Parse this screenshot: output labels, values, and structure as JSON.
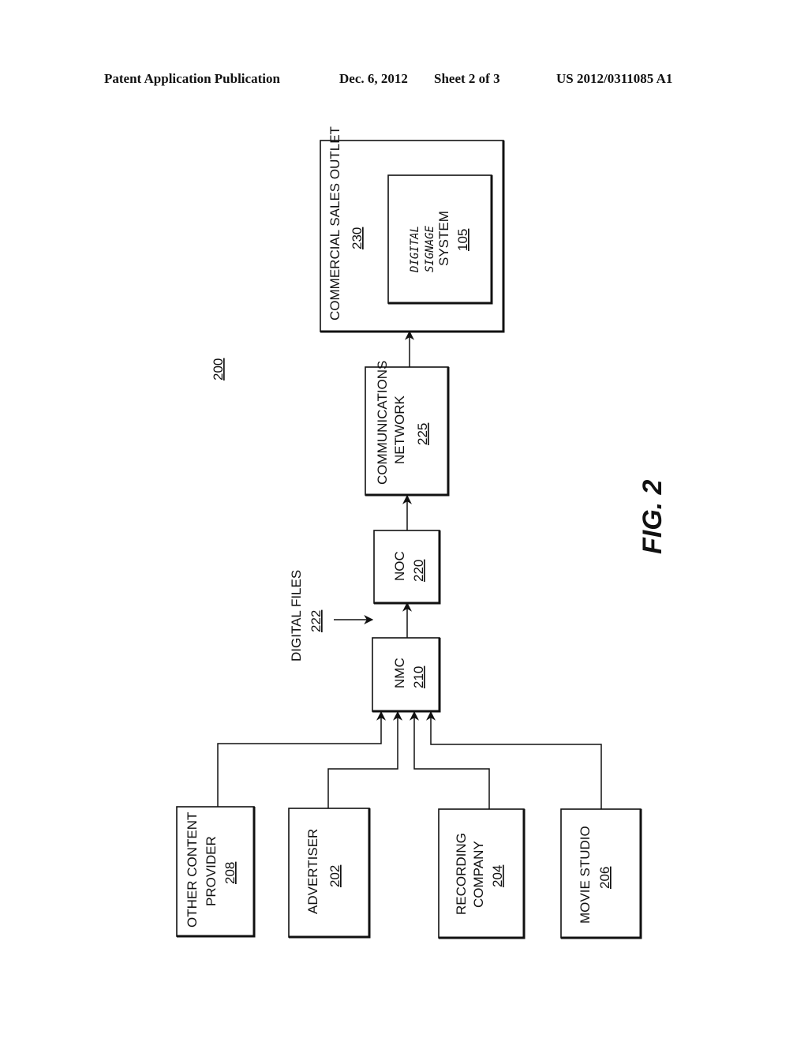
{
  "header": {
    "publication_type": "Patent Application Publication",
    "date": "Dec. 6, 2012",
    "sheet": "Sheet 2 of 3",
    "number": "US 2012/0311085 A1"
  },
  "figure": {
    "label": "FIG. 2",
    "reference": "200"
  },
  "nodes": {
    "commercial_sales_outlet": {
      "lines": [
        "COMMERCIAL SALES OUTLET"
      ],
      "ref": "230"
    },
    "digital_signage_system": {
      "lines": [
        "DIGITAL",
        "SIGNAGE",
        "SYSTEM"
      ],
      "ref": "105"
    },
    "communications_network": {
      "lines": [
        "COMMUNICATIONS",
        "NETWORK"
      ],
      "ref": "225"
    },
    "noc": {
      "lines": [
        "NOC"
      ],
      "ref": "220"
    },
    "nmc": {
      "lines": [
        "NMC"
      ],
      "ref": "210"
    },
    "digital_files": {
      "lines": [
        "DIGITAL FILES"
      ],
      "ref": "222"
    },
    "other_content_provider": {
      "lines": [
        "OTHER CONTENT",
        "PROVIDER"
      ],
      "ref": "208"
    },
    "advertiser": {
      "lines": [
        "ADVERTISER"
      ],
      "ref": "202"
    },
    "recording_company": {
      "lines": [
        "RECORDING",
        "COMPANY"
      ],
      "ref": "204"
    },
    "movie_studio": {
      "lines": [
        "MOVIE STUDIO"
      ],
      "ref": "206"
    }
  },
  "edges": [
    [
      "other_content_provider",
      "nmc"
    ],
    [
      "advertiser",
      "nmc"
    ],
    [
      "recording_company",
      "nmc"
    ],
    [
      "movie_studio",
      "nmc"
    ],
    [
      "digital_files",
      "noc"
    ],
    [
      "nmc",
      "noc"
    ],
    [
      "noc",
      "communications_network"
    ],
    [
      "communications_network",
      "commercial_sales_outlet"
    ]
  ]
}
